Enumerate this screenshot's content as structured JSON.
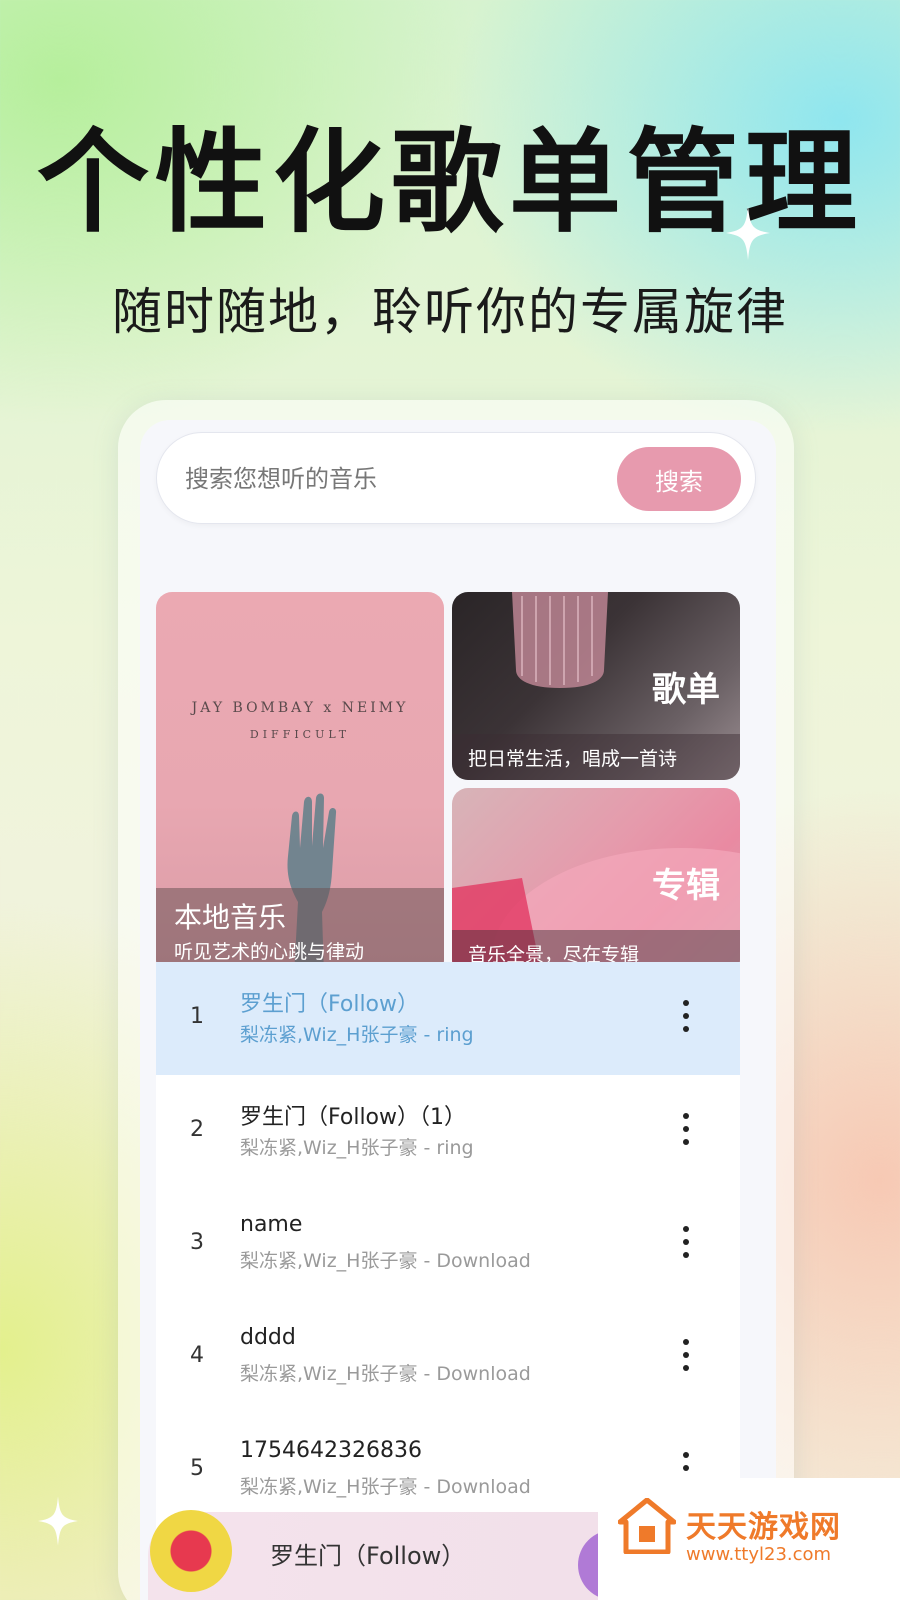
{
  "header": {
    "title": "个性化歌单管理",
    "subtitle": "随时随地，聆听你的专属旋律"
  },
  "search": {
    "placeholder": "搜索您想听的音乐",
    "button_label": "搜索"
  },
  "cards": {
    "local": {
      "title": "本地音乐",
      "subtitle": "听见艺术的心跳与律动",
      "album_artist": "JAY BOMBAY x NEIMY",
      "album_name": "DIFFICULT"
    },
    "playlist": {
      "title": "歌单",
      "subtitle": "把日常生活，唱成一首诗"
    },
    "album": {
      "title": "专辑",
      "subtitle": "音乐全景，尽在专辑"
    }
  },
  "songs": [
    {
      "index": "1",
      "title": "罗生门（Follow）",
      "artist": "梨冻紧,Wiz_H张子豪 - ring",
      "active": true
    },
    {
      "index": "2",
      "title": "罗生门（Follow）（1）",
      "artist": "梨冻紧,Wiz_H张子豪 - ring",
      "active": false
    },
    {
      "index": "3",
      "title": "name",
      "artist": "梨冻紧,Wiz_H张子豪 - Download",
      "active": false
    },
    {
      "index": "4",
      "title": "dddd",
      "artist": "梨冻紧,Wiz_H张子豪 - Download",
      "active": false
    },
    {
      "index": "5",
      "title": "1754642326836",
      "artist": "梨冻紧,Wiz_H张子豪 - Download",
      "active": false
    }
  ],
  "player": {
    "now_playing": "罗生门（Follow）"
  },
  "watermark": {
    "name": "天天游戏网",
    "url": "www.ttyl23.com"
  },
  "colors": {
    "accent": "#e79aae",
    "active_row": "#dcebfb",
    "active_text": "#5c9fd0",
    "watermark": "#ef7a2a"
  }
}
